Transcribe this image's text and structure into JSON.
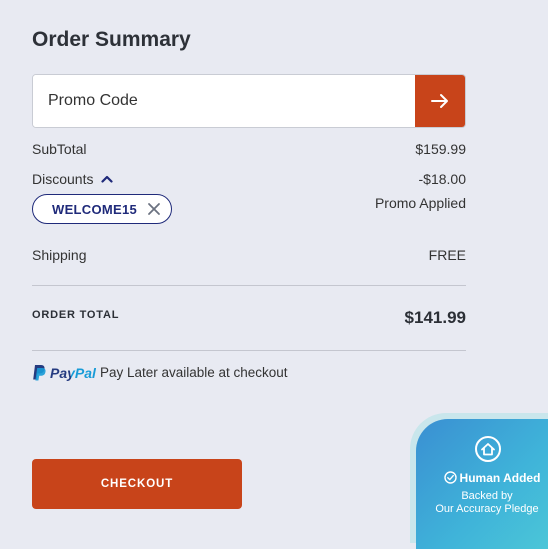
{
  "summary": {
    "title": "Order Summary",
    "promo_placeholder": "Promo Code",
    "subtotal_label": "SubTotal",
    "subtotal_value": "$159.99",
    "discounts_label": "Discounts",
    "discount_value": "-$18.00",
    "promo_applied": "Promo Applied",
    "promo_chip": "WELCOME15",
    "shipping_label": "Shipping",
    "shipping_value": "FREE",
    "total_label": "ORDER TOTAL",
    "total_value": "$141.99",
    "paypal_brand": "PayPal",
    "paypal_text": "Pay Later available at checkout",
    "checkout_label": "CHECKOUT"
  },
  "badge": {
    "title": "Human Added",
    "subtitle_line1": "Backed by",
    "subtitle_line2": "Our Accuracy Pledge"
  },
  "colors": {
    "accent": "#c8441a",
    "navy": "#1f2a7a",
    "background": "#e8eaf2",
    "paypal_dark": "#253b80",
    "paypal_light": "#179bd7"
  }
}
